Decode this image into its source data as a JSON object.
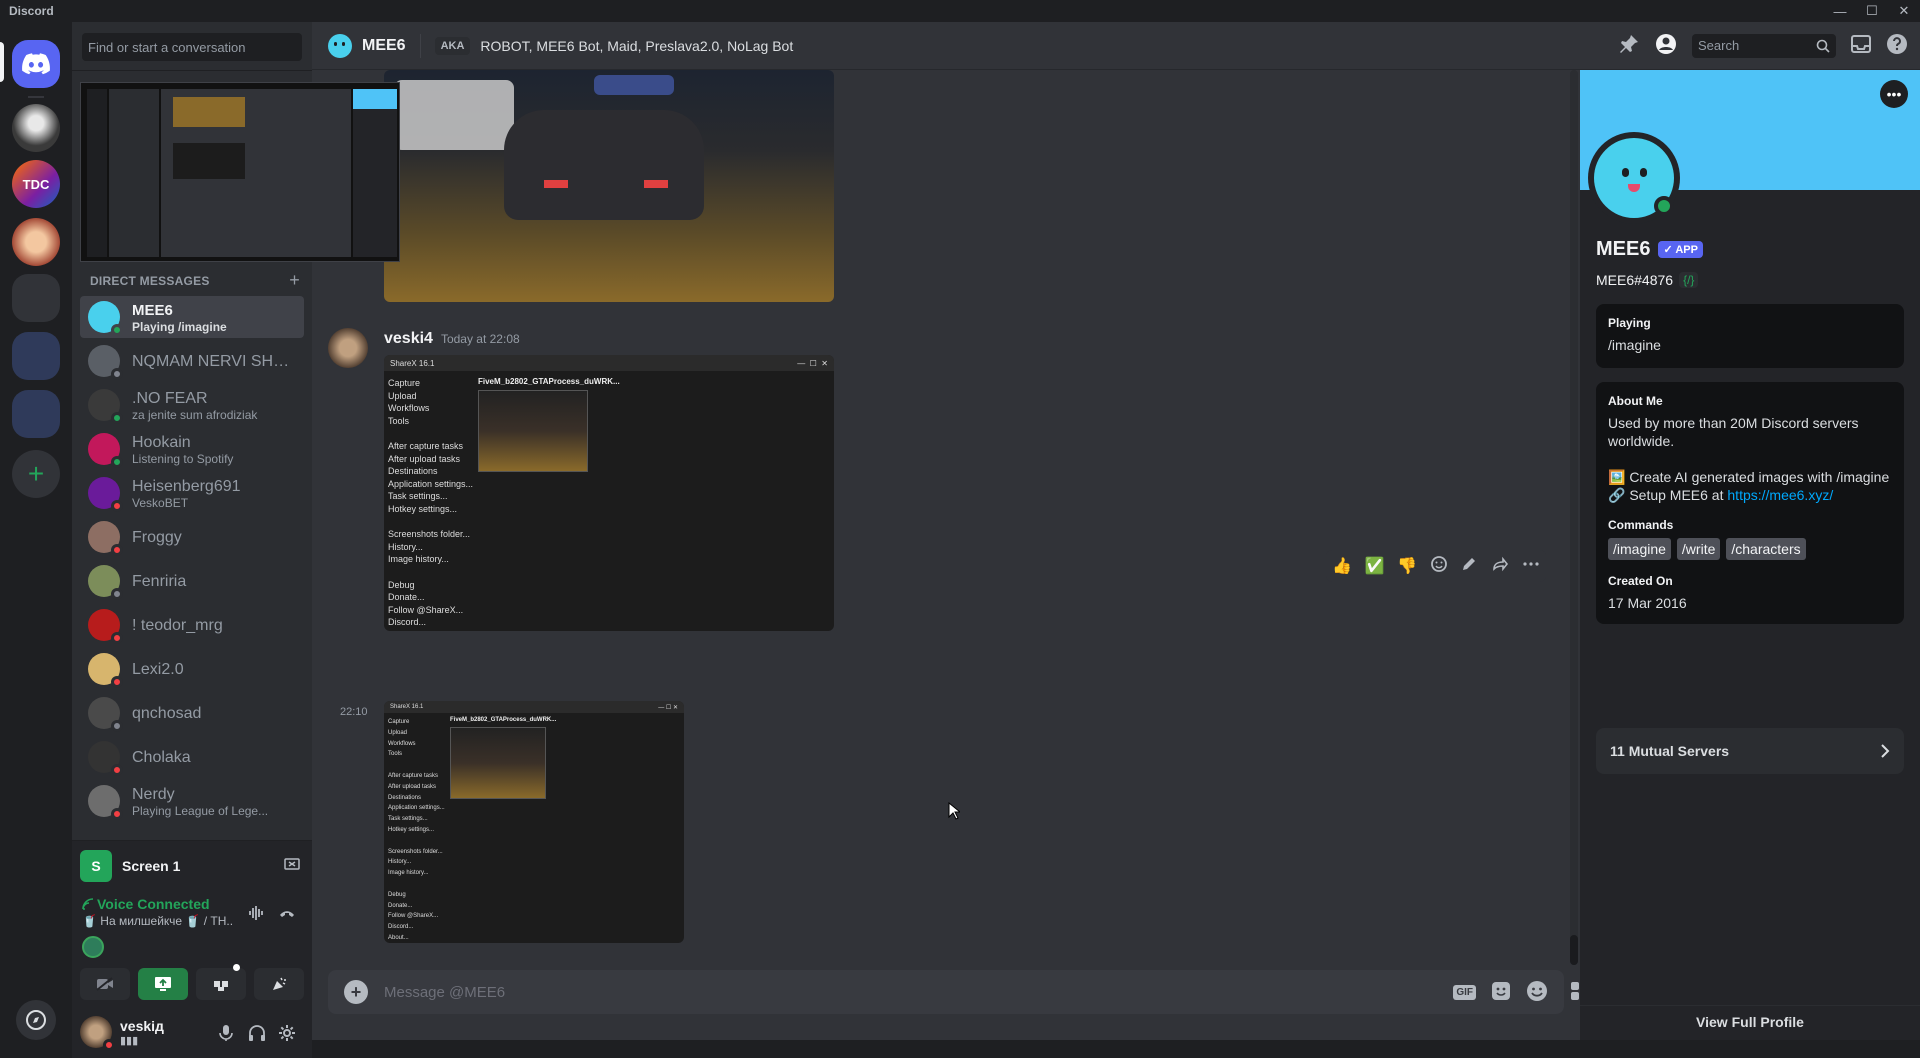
{
  "app_title": "Discord",
  "window_controls": [
    "—",
    "☐",
    "✕"
  ],
  "dm_search_placeholder": "Find or start a conversation",
  "dm_section_title": "DIRECT MESSAGES",
  "dms": [
    {
      "name": "MEE6",
      "sub": "Playing /imagine",
      "status": "on",
      "color": "#49d0ed",
      "active": true
    },
    {
      "name": "NQMAM NERVI SHA ...",
      "sub": "",
      "status": "off",
      "color": "#5a5f66"
    },
    {
      "name": ".NO FEAR",
      "sub": "za jenite sum afrodiziak",
      "status": "on",
      "color": "#3a3a3a"
    },
    {
      "name": "Hookain",
      "sub": "Listening to Spotify",
      "status": "on",
      "color": "#c2185b"
    },
    {
      "name": "Heisenberg691",
      "sub": "VeskoBET",
      "status": "dnd",
      "color": "#6a1b9a"
    },
    {
      "name": "Froggy",
      "sub": "",
      "status": "dnd",
      "color": "#8d6e63"
    },
    {
      "name": "Fenriria",
      "sub": "",
      "status": "off",
      "color": "#7c8d5a"
    },
    {
      "name": "! teodor_mrg",
      "sub": "",
      "status": "dnd",
      "color": "#b71c1c"
    },
    {
      "name": "Lexi2.0",
      "sub": "",
      "status": "dnd",
      "color": "#d7b56d"
    },
    {
      "name": "qnchosad",
      "sub": "",
      "status": "off",
      "color": "#4a4a4a"
    },
    {
      "name": "Cholaka",
      "sub": "",
      "status": "dnd",
      "color": "#333333"
    },
    {
      "name": "Nerdy",
      "sub": "Playing League of Lege...",
      "status": "dnd",
      "color": "#6d6d6d"
    }
  ],
  "screen_share": {
    "icon_letter": "S",
    "label": "Screen 1"
  },
  "voice": {
    "title": "Voice Connected",
    "channel": "🥤 На милшейкче 🥤 / TH..."
  },
  "user": {
    "name": "veskiд",
    "status": "▮▮▮"
  },
  "chat_header": {
    "name": "MEE6",
    "aka_label": "AKA",
    "aka_names": "ROBOT, MEE6 Bot, Maid, Preslava2.0, NoLag Bot",
    "search_placeholder": "Search"
  },
  "message": {
    "author": "veski4",
    "timestamp": "Today at 22:08",
    "followup_time": "22:10"
  },
  "reactions": [
    "👍",
    "✅",
    "👎"
  ],
  "sharex": {
    "title": "ShareX 16.1",
    "file": "FiveM_b2802_GTAProcess_duWRK...",
    "menu": [
      "Capture",
      "Upload",
      "Workflows",
      "Tools",
      "",
      "After capture tasks",
      "After upload tasks",
      "Destinations",
      "Application settings...",
      "Task settings...",
      "Hotkey settings...",
      "",
      "Screenshots folder...",
      "History...",
      "Image history...",
      "",
      "Debug",
      "Donate...",
      "Follow @ShareX...",
      "Discord...",
      "About..."
    ]
  },
  "composer_placeholder": "Message @MEE6",
  "composer_gif": "GIF",
  "profile": {
    "name": "MEE6",
    "badge": "✓ APP",
    "tag": "MEE6#4876",
    "code_badge": "{/}",
    "playing_title": "Playing",
    "playing_value": "/imagine",
    "about_title": "About Me",
    "about_text": "Used by more than 20M Discord servers worldwide.",
    "about_line2": "🖼️ Create AI generated images with /imagine",
    "about_line3_prefix": "🔗 Setup MEE6 at ",
    "about_link": "https://mee6.xyz/",
    "commands_title": "Commands",
    "commands": [
      "/imagine",
      "/write",
      "/characters"
    ],
    "created_title": "Created On",
    "created_value": "17 Mar 2016",
    "mutual": "11 Mutual Servers",
    "view_full": "View Full Profile"
  }
}
